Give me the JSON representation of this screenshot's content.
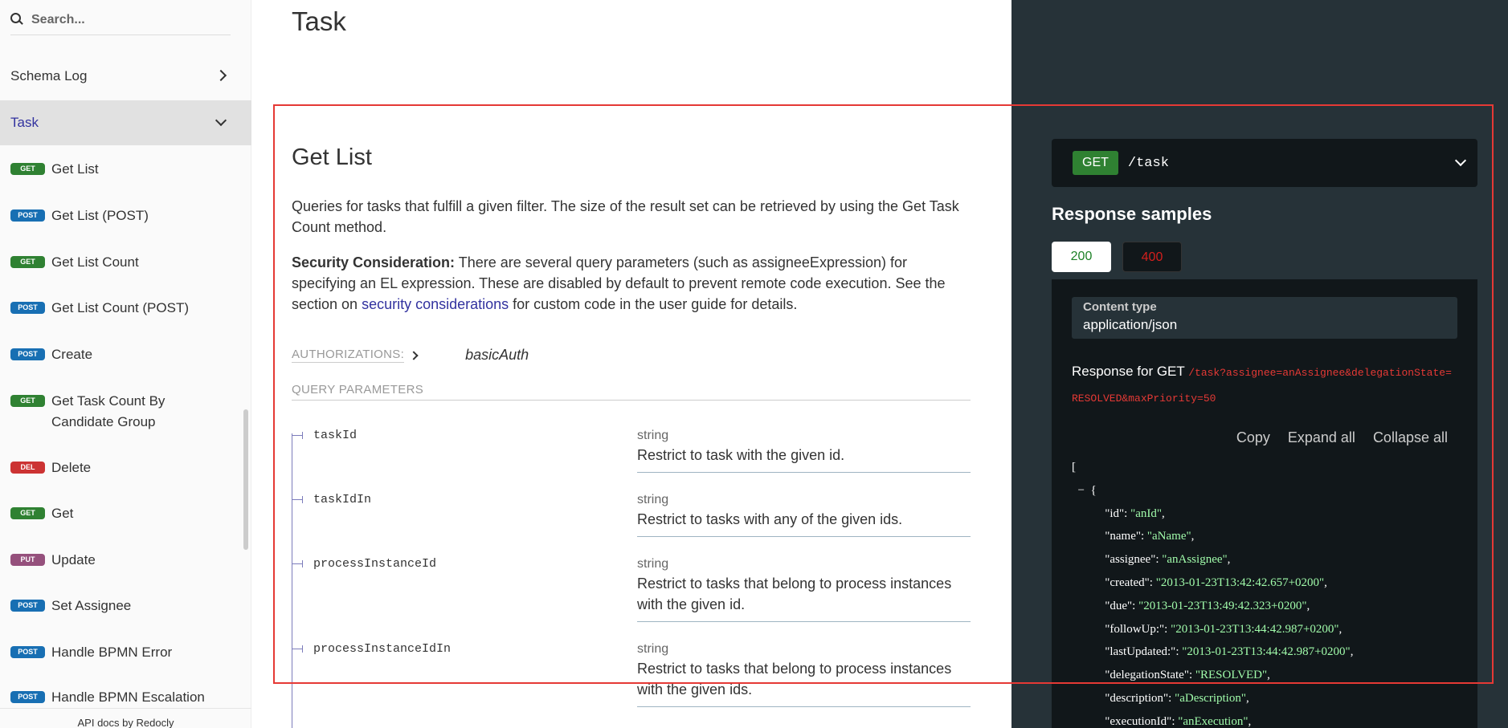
{
  "sidebar": {
    "search_placeholder": "Search...",
    "schema_log": "Schema Log",
    "task_group": "Task",
    "items": [
      {
        "method": "GET",
        "label": "Get List"
      },
      {
        "method": "POST",
        "label": "Get List (POST)"
      },
      {
        "method": "GET",
        "label": "Get List Count"
      },
      {
        "method": "POST",
        "label": "Get List Count (POST)"
      },
      {
        "method": "POST",
        "label": "Create"
      },
      {
        "method": "GET",
        "label": "Get Task Count By Candidate Group"
      },
      {
        "method": "DEL",
        "label": "Delete"
      },
      {
        "method": "GET",
        "label": "Get"
      },
      {
        "method": "PUT",
        "label": "Update"
      },
      {
        "method": "POST",
        "label": "Set Assignee"
      },
      {
        "method": "POST",
        "label": "Handle BPMN Error"
      },
      {
        "method": "POST",
        "label": "Handle BPMN Escalation"
      }
    ],
    "footer": "API docs by Redocly"
  },
  "main": {
    "page_title": "Task",
    "section_title": "Get List",
    "description": "Queries for tasks that fulfill a given filter. The size of the result set can be retrieved by using the Get Task Count method.",
    "security_label": "Security Consideration:",
    "security_text": " There are several query parameters (such as assigneeExpression) for specifying an EL expression. These are disabled by default to prevent remote code execution. See the section on ",
    "security_link": "security considerations",
    "security_tail": " for custom code in the user guide for details.",
    "authorizations_label": "AUTHORIZATIONS:",
    "authorizations_value": "basicAuth",
    "query_params_label": "QUERY PARAMETERS",
    "params": [
      {
        "name": "taskId",
        "type": "string",
        "desc": "Restrict to task with the given id."
      },
      {
        "name": "taskIdIn",
        "type": "string",
        "desc": "Restrict to tasks with any of the given ids."
      },
      {
        "name": "processInstanceId",
        "type": "string",
        "desc": "Restrict to tasks that belong to process instances with the given id."
      },
      {
        "name": "processInstanceIdIn",
        "type": "string",
        "desc": "Restrict to tasks that belong to process instances with the given ids."
      }
    ]
  },
  "right_panel": {
    "method": "GET",
    "path": "/task",
    "response_samples": "Response samples",
    "tab_200": "200",
    "tab_400": "400",
    "content_type_label": "Content type",
    "content_type_value": "application/json",
    "response_for": "Response for GET",
    "response_url": "/task?assignee=anAssignee&delegationState=RESOLVED&maxPriority=50",
    "copy": "Copy",
    "expand_all": "Expand all",
    "collapse_all": "Collapse all",
    "json_open": "[",
    "json_obj_open": "{",
    "json_collapse": "−",
    "json_rows": [
      {
        "key": "\"id\"",
        "value": "\"anId\""
      },
      {
        "key": "\"name\"",
        "value": "\"aName\""
      },
      {
        "key": "\"assignee\"",
        "value": "\"anAssignee\""
      },
      {
        "key": "\"created\"",
        "value": "\"2013-01-23T13:42:42.657+0200\""
      },
      {
        "key": "\"due\"",
        "value": "\"2013-01-23T13:49:42.323+0200\""
      },
      {
        "key": "\"followUp:\"",
        "value": "\"2013-01-23T13:44:42.987+0200\""
      },
      {
        "key": "\"lastUpdated:\"",
        "value": "\"2013-01-23T13:44:42.987+0200\""
      },
      {
        "key": "\"delegationState\"",
        "value": "\"RESOLVED\""
      },
      {
        "key": "\"description\"",
        "value": "\"aDescription\""
      },
      {
        "key": "\"executionId\"",
        "value": "\"anExecution\""
      }
    ]
  },
  "colors": {
    "get": "#2f8132",
    "post": "#186fb3",
    "del": "#cc3333",
    "put": "#95507c",
    "link": "#32329f",
    "highlight": "#e53935"
  }
}
